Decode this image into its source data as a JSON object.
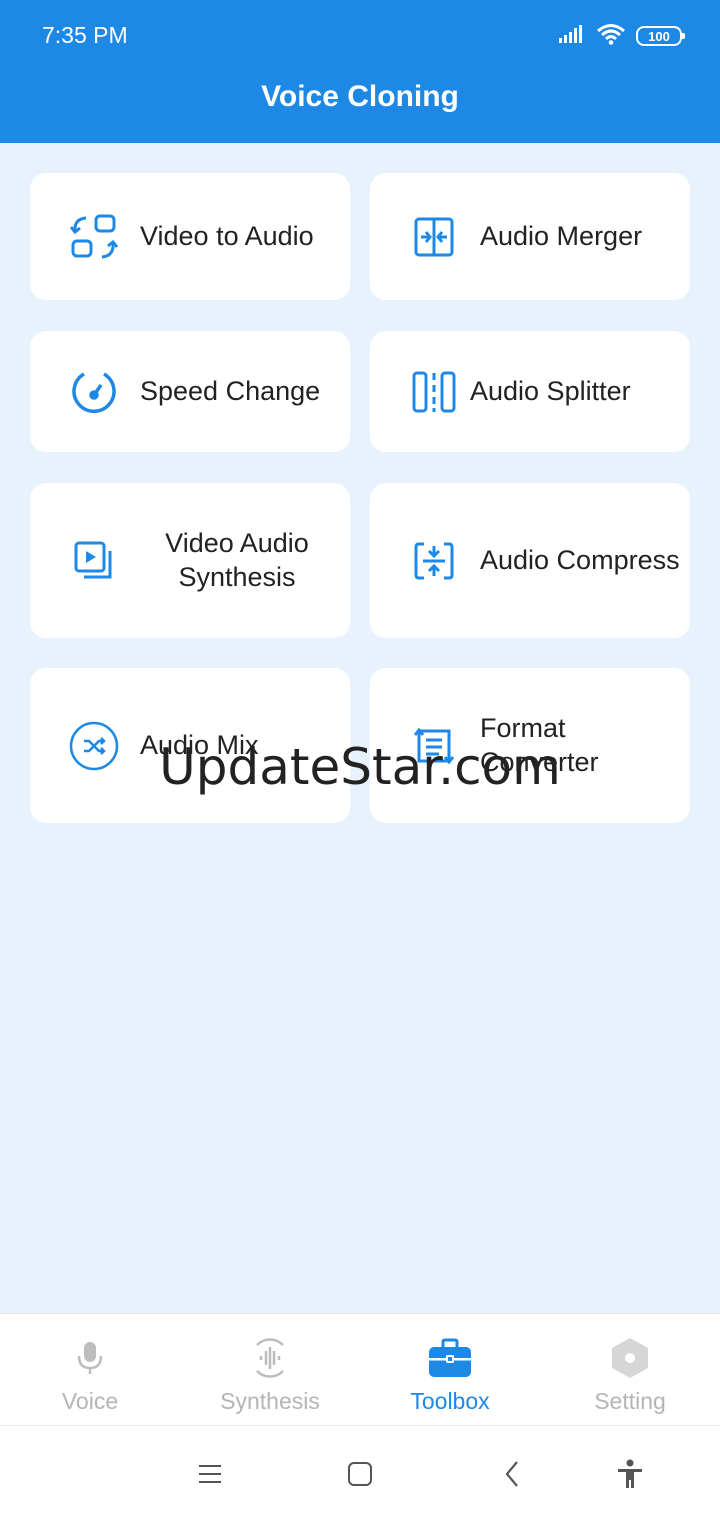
{
  "status_bar": {
    "time": "7:35 PM",
    "battery": "100",
    "icons": [
      "signal-icon",
      "wifi-icon",
      "battery-icon"
    ]
  },
  "header": {
    "title": "Voice Cloning",
    "bg_color": "#1e88e5"
  },
  "tools": [
    {
      "label": "Video to Audio",
      "icon": "video-to-audio-icon"
    },
    {
      "label": "Audio Merger",
      "icon": "merge-icon"
    },
    {
      "label": "Speed Change",
      "icon": "speedometer-icon"
    },
    {
      "label": "Audio Splitter",
      "icon": "split-icon"
    },
    {
      "label": "Video Audio Synthesis",
      "icon": "video-play-icon"
    },
    {
      "label": "Audio Compress",
      "icon": "compress-icon"
    },
    {
      "label": "Audio Mix",
      "icon": "shuffle-icon"
    },
    {
      "label": "Format Converter",
      "icon": "format-convert-icon"
    }
  ],
  "watermark": "UpdateStar.com",
  "bottom_nav": {
    "items": [
      {
        "label": "Voice",
        "icon": "microphone-icon",
        "active": false
      },
      {
        "label": "Synthesis",
        "icon": "waveform-icon",
        "active": false
      },
      {
        "label": "Toolbox",
        "icon": "toolbox-icon",
        "active": true
      },
      {
        "label": "Setting",
        "icon": "settings-hexagon-icon",
        "active": false
      }
    ]
  },
  "system_nav": [
    "menu-icon",
    "home-icon",
    "back-icon",
    "accessibility-icon"
  ],
  "colors": {
    "accent": "#1e88e5",
    "background": "#e8f2fc",
    "inactive": "#b5b5b5"
  }
}
